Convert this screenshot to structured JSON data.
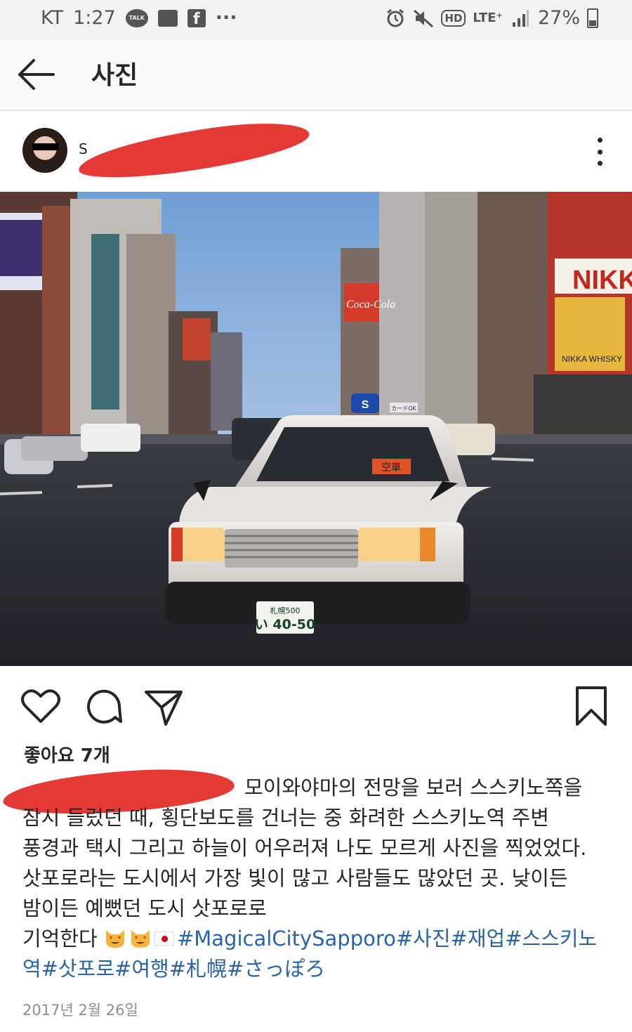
{
  "status_bar": {
    "carrier": "KT",
    "time": "1:27",
    "talk_label": "TALK",
    "facebook_glyph": "f",
    "more_notifications": "···",
    "hd_label": "HD",
    "lte_label": "LTE⁺",
    "battery": "27%",
    "icons": [
      "kakaotalk-icon",
      "image-icon",
      "facebook-icon",
      "alarm-icon",
      "mute-icon",
      "signal-icon",
      "battery-icon"
    ]
  },
  "app_bar": {
    "title": "사진",
    "back_icon": "arrow-left-icon"
  },
  "post": {
    "username": "S",
    "photo_plate_top": "札幌500",
    "photo_plate_bottom": "い 40-50",
    "photo_signs": [
      "NIKK",
      "NIKKA WHISKY",
      "Coca-Cola",
      "空車",
      "カードOK",
      "S"
    ],
    "likes": "좋아요 7개",
    "caption_lines": [
      "모이와야마의 전망을 보러 스스키노쪽을",
      "잠시 들렀던 때, 횡단보도를 건너는 중 화려한 스스키노역 주변",
      "풍경과 택시 그리고 하늘이 어우러져 나도 모르게 사진을 찍었었다.",
      "삿포로라는 도시에서 가장 빛이 많고 사람들도 많았던 곳. 낮이든",
      "밤이든 예뻤던 도시 삿포로로"
    ],
    "caption_last_prefix": "기억한다",
    "hashtags_line1": "#MagicalCitySapporo#사진#재업#스스키노",
    "hashtags_line2": "역#삿포로#여행#札幌#さっぽろ",
    "date": "2017년 2월 26일"
  },
  "colors": {
    "hashtag": "#2a64a8",
    "redaction": "#e53935",
    "status_bar_bg": "#f2f2f2"
  }
}
